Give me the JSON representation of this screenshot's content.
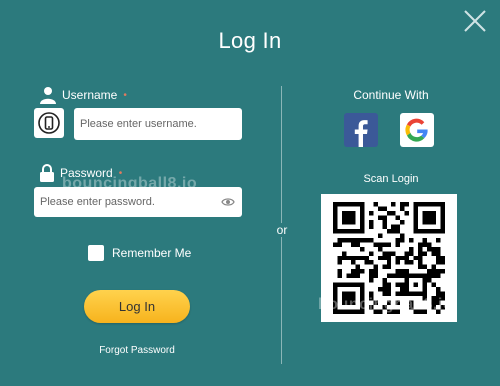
{
  "title": "Log In",
  "close_icon": "close-icon",
  "username": {
    "label": "Username",
    "required_mark": "•",
    "placeholder": "Please enter username."
  },
  "password": {
    "label": "Password",
    "required_mark": "•",
    "placeholder": "Please enter password."
  },
  "remember_label": "Remember Me",
  "login_button": "Log In",
  "forgot_link": "Forgot Password",
  "or_label": "or",
  "continue_label": "Continue With",
  "social": [
    "facebook-icon",
    "google-icon"
  ],
  "scan_label": "Scan Login",
  "watermark_1": "bouncingball8.io",
  "watermark_2": "bouncingball8.io",
  "colors": {
    "background": "#2c7a7d",
    "button": "#f7b31d",
    "facebook": "#3b5998"
  }
}
